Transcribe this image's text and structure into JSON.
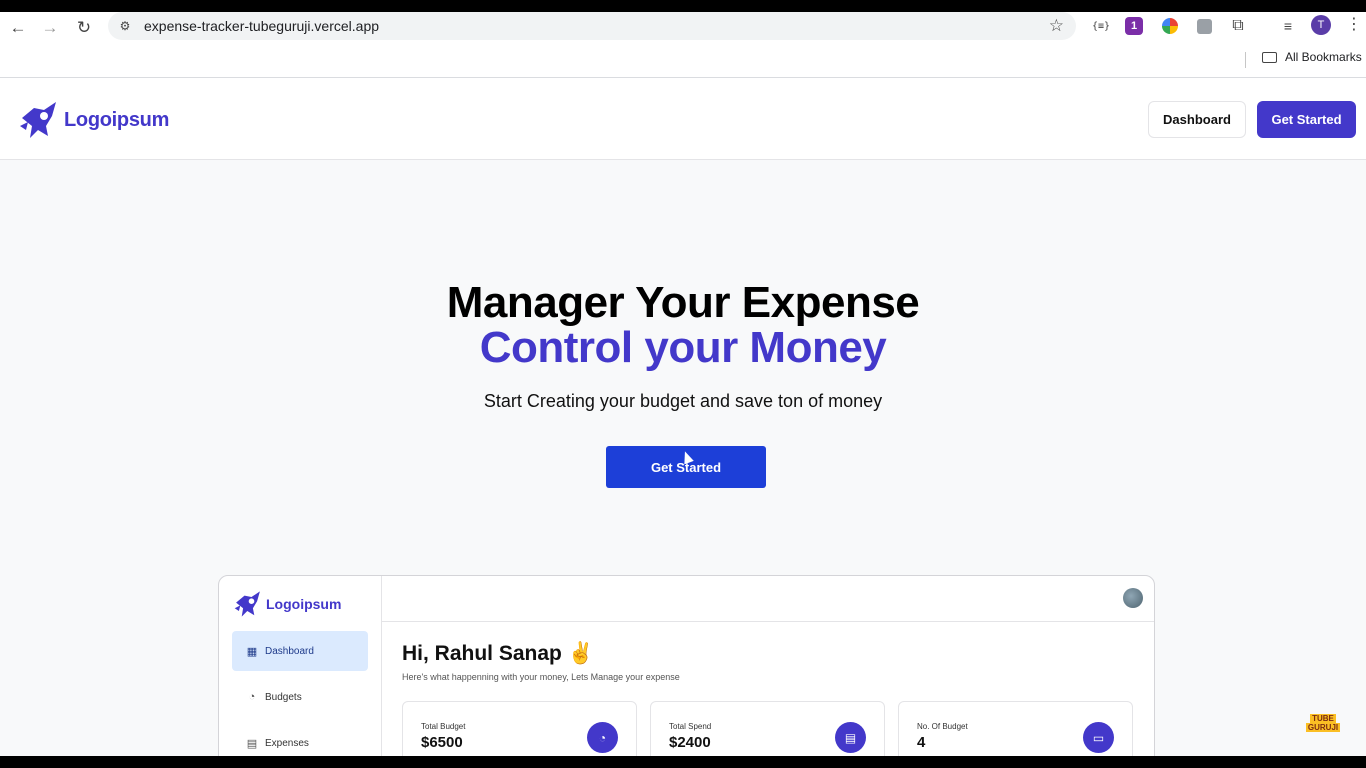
{
  "browser": {
    "url": "expense-tracker-tubeguruji.vercel.app",
    "profile_initial": "T",
    "extension_badge": "1",
    "bookmarks_label": "All Bookmarks"
  },
  "header": {
    "logo_text": "Logoipsum",
    "dashboard_label": "Dashboard",
    "get_started_label": "Get Started"
  },
  "hero": {
    "title_line1": "Manager Your Expense",
    "title_line2": "Control your Money",
    "subtitle": "Start Creating your budget and save ton of money",
    "cta_label": "Get Started"
  },
  "preview": {
    "logo_text": "Logoipsum",
    "nav": [
      {
        "label": "Dashboard",
        "icon": "grid-icon"
      },
      {
        "label": "Budgets",
        "icon": "piggy-bank-icon"
      },
      {
        "label": "Expenses",
        "icon": "receipt-icon"
      }
    ],
    "greeting": "Hi, Rahul Sanap ✌️",
    "greeting_sub": "Here's what happenning with your money, Lets Manage your expense",
    "cards": [
      {
        "label": "Total Budget",
        "value": "$6500",
        "icon": "piggy-bank-icon"
      },
      {
        "label": "Total Spend",
        "value": "$2400",
        "icon": "receipt-icon"
      },
      {
        "label": "No. Of Budget",
        "value": "4",
        "icon": "wallet-icon"
      }
    ]
  },
  "colors": {
    "brand": "#4338ca",
    "cta": "#1d3fd8",
    "hero_bg": "#f8f9fa"
  }
}
